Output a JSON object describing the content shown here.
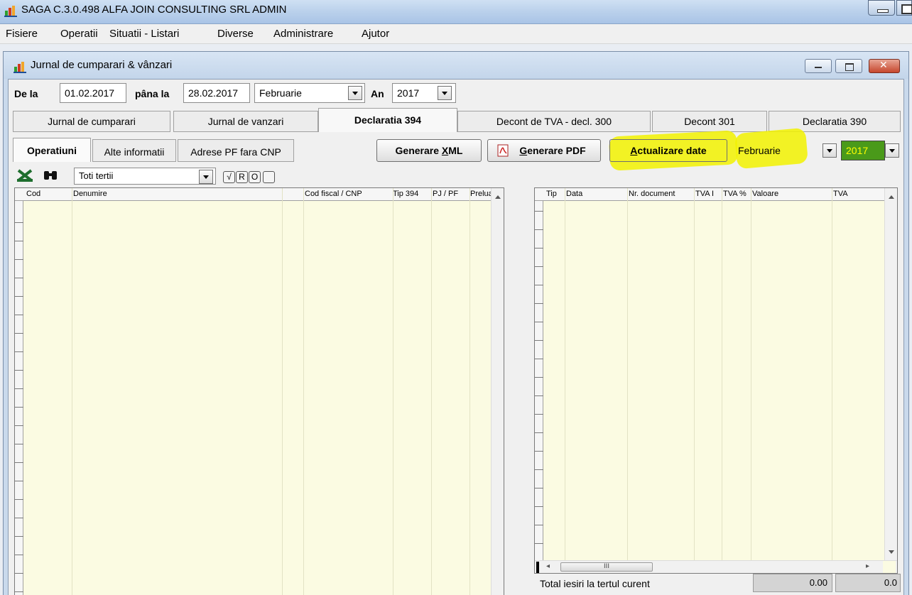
{
  "app": {
    "title": "SAGA C.3.0.498  ALFA JOIN CONSULTING SRL  ADMIN",
    "menu": [
      "Fisiere",
      "Operatii",
      "Situatii - Listari",
      "Diverse",
      "Administrare",
      "Ajutor"
    ]
  },
  "window": {
    "title": "Jurnal de cumparari & vânzari"
  },
  "period": {
    "from_label": "De la",
    "from_value": "01.02.2017",
    "to_label": "pâna la",
    "to_value": "28.02.2017",
    "month_value": "Februarie",
    "year_label": "An",
    "year_value": "2017"
  },
  "tabs": [
    {
      "label": "Jurnal de cumparari",
      "active": false
    },
    {
      "label": "Jurnal de vanzari",
      "active": false
    },
    {
      "label": "Declaratia 394",
      "active": true
    },
    {
      "label": "Decont de TVA - decl. 300",
      "active": false
    },
    {
      "label": "Decont 301",
      "active": false
    },
    {
      "label": "Declaratia 390",
      "active": false
    }
  ],
  "subtabs": [
    {
      "label": "Operatiuni",
      "active": true
    },
    {
      "label": "Alte informatii",
      "active": false
    },
    {
      "label": "Adrese PF fara CNP",
      "active": false
    }
  ],
  "actions": {
    "xml_button": "Generare XML",
    "pdf_button": "Generare PDF",
    "update_button": "Actualizare date",
    "month_value": "Februarie",
    "year_value": "2017",
    "highlight_color": "#f2f200",
    "year_bg_color": "#4a9a1a"
  },
  "filter": {
    "tertii_value": "Toti tertii",
    "check_symbol": "√",
    "r_label": "R",
    "o_label": "O"
  },
  "left_grid": {
    "columns": [
      "Cod",
      "Denumire",
      "Cod fiscal / CNP",
      "Tip 394",
      "PJ / PF",
      "Preluat"
    ]
  },
  "right_grid": {
    "columns": [
      "Tip",
      "Data",
      "Nr. document",
      "TVA I",
      "TVA %",
      "Valoare",
      "TVA"
    ]
  },
  "totals": {
    "label": "Total iesiri la tertul curent",
    "value1": "0.00",
    "value2": "0.0",
    "scroll_grip": "III"
  }
}
